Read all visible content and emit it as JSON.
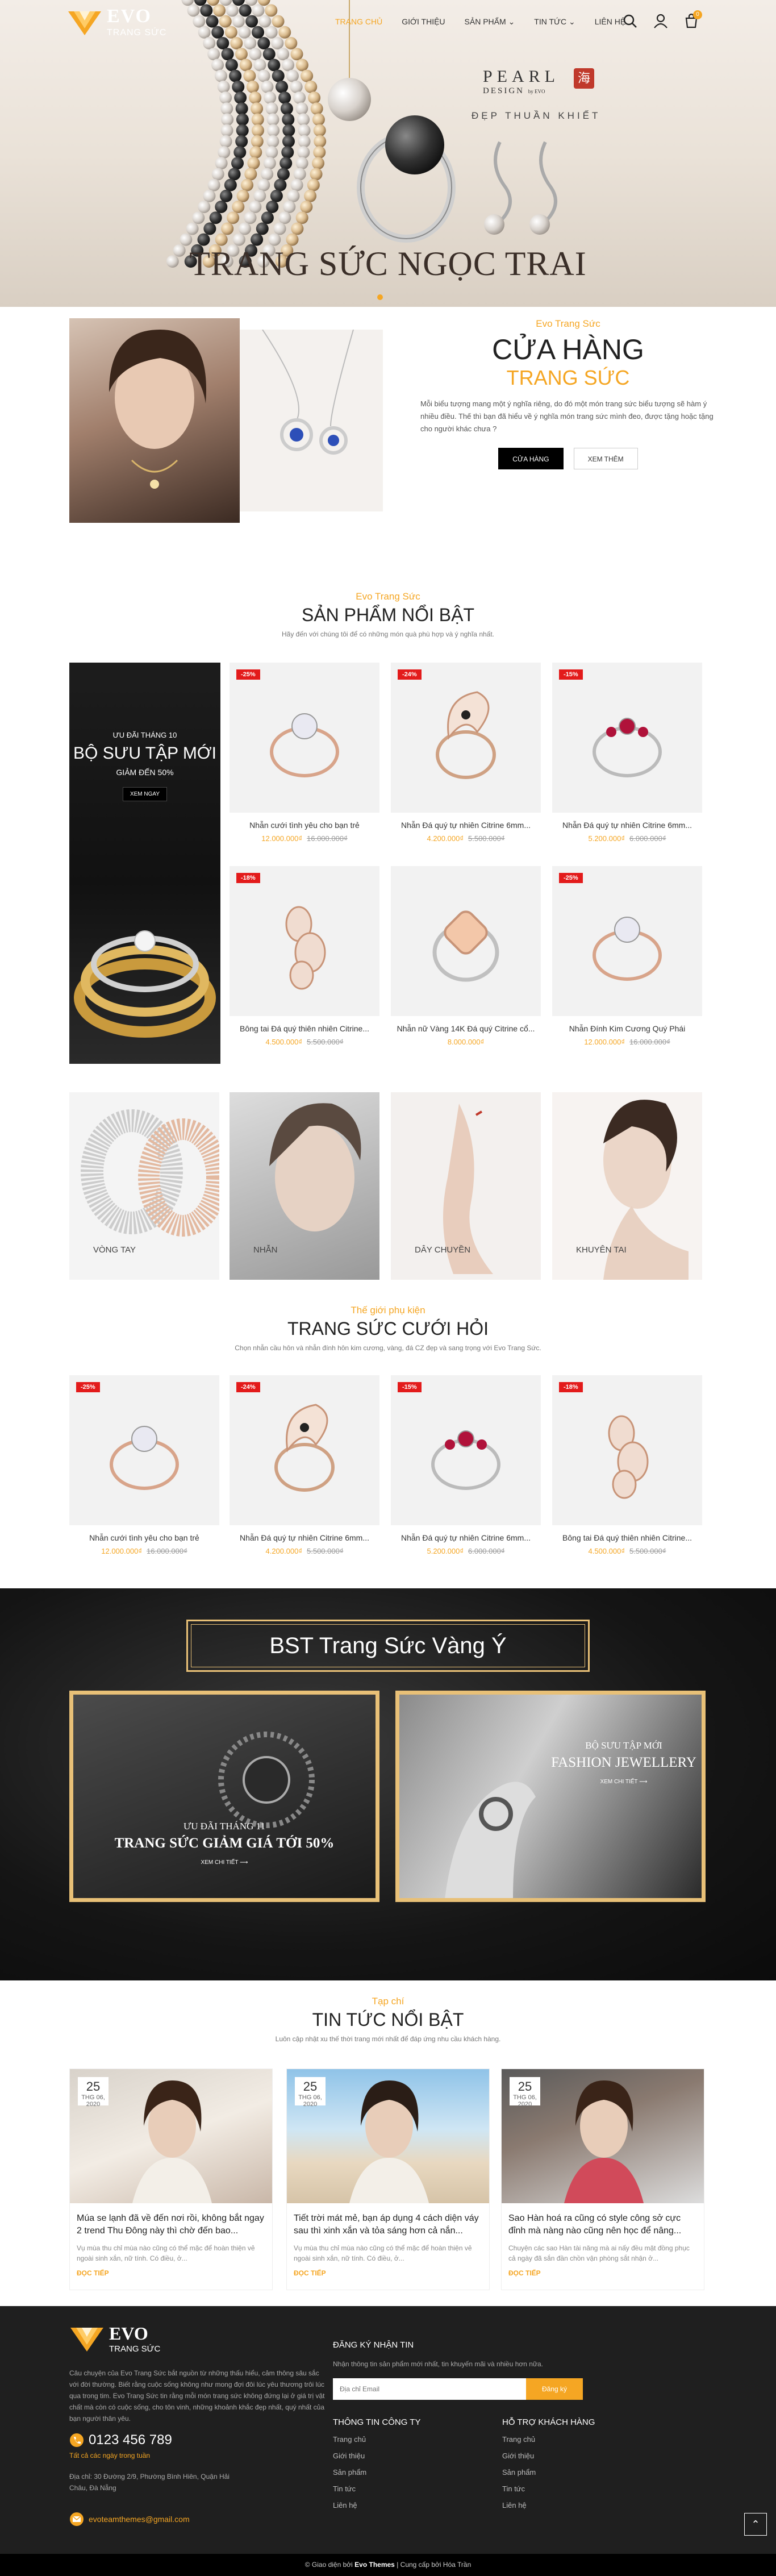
{
  "colors": {
    "accent": "#f5a623",
    "sale": "#e31b1b",
    "dark": "#1f1f1f",
    "gold_frame": "#e8c077"
  },
  "header": {
    "logo": {
      "name": "EVO",
      "sub": "TRANG SỨC"
    },
    "nav": [
      "TRANG CHỦ",
      "GIỚI THIỆU",
      "SẢN PHẨM",
      "TIN TỨC",
      "LIÊN HỆ"
    ],
    "cart_count": "0",
    "icons": [
      "search-icon",
      "user-icon",
      "cart-icon"
    ]
  },
  "hero": {
    "brand": "PEARL",
    "design": "DESIGN",
    "by": "by EVO",
    "seal": "海",
    "tagline": "ĐẸP THUẦN KHIẾT",
    "title": "TRANG SỨC NGỌC TRAI"
  },
  "about": {
    "kicker": "Evo Trang Sức",
    "title_1": "CỬA HÀNG",
    "title_2": "TRANG SỨC",
    "text": "Mỗi biểu tượng mang một ý nghĩa riêng, do đó một món trang sức biểu tượng sẽ hàm ý nhiều điều. Thế thì bạn đã hiểu về ý nghĩa món trang sức mình đeo, được tặng hoặc tặng cho người khác chưa ?",
    "btn_shop": "CỬA HÀNG",
    "btn_more": "XEM THÊM"
  },
  "featured": {
    "kicker": "Evo Trang Sức",
    "title": "SẢN PHẨM NỔI BẬT",
    "desc": "Hãy đến với chúng tôi để có những món quà phù hợp và ý nghĩa nhất.",
    "promo": {
      "line1": "ƯU ĐÃI THÁNG 10",
      "line2": "BỘ SƯU TẬP MỚI",
      "line3": "GIẢM ĐẾN 50%",
      "btn": "XEM NGAY"
    },
    "products": [
      {
        "sale": "-25%",
        "name": "Nhẫn cưới tình yêu cho bạn trẻ",
        "price": "12.000.000₫",
        "old": "16.000.000₫"
      },
      {
        "sale": "-24%",
        "name": "Nhẫn Đá quý tự nhiên Citrine 6mm...",
        "price": "4.200.000₫",
        "old": "5.500.000₫"
      },
      {
        "sale": "-15%",
        "name": "Nhẫn Đá quý tự nhiên Citrine 6mm...",
        "price": "5.200.000₫",
        "old": "6.000.000₫"
      },
      {
        "sale": "-18%",
        "name": "Bông tai Đá quý thiên nhiên Citrine...",
        "price": "4.500.000₫",
        "old": "5.500.000₫"
      },
      {
        "sale": "",
        "name": "Nhẫn nữ Vàng 14K Đá quý Citrine cổ...",
        "price": "8.000.000₫",
        "old": ""
      },
      {
        "sale": "-25%",
        "name": "Nhẫn Đính Kim Cương Quý Phái",
        "price": "12.000.000₫",
        "old": "16.000.000₫"
      }
    ]
  },
  "categories": [
    "VÒNG TAY",
    "NHẪN",
    "DÂY CHUYỀN",
    "KHUYÊN TAI"
  ],
  "wedding": {
    "kicker": "Thế giới phụ kiện",
    "title": "TRANG SỨC CƯỚI HỎI",
    "desc": "Chọn nhẫn cầu hôn và nhẫn đính hôn kim cương, vàng, đá CZ đẹp và sang trọng với Evo Trang Sức.",
    "products": [
      {
        "sale": "-25%",
        "name": "Nhẫn cưới tình yêu cho bạn trẻ",
        "price": "12.000.000₫",
        "old": "16.000.000₫"
      },
      {
        "sale": "-24%",
        "name": "Nhẫn Đá quý tự nhiên Citrine 6mm...",
        "price": "4.200.000₫",
        "old": "5.500.000₫"
      },
      {
        "sale": "-15%",
        "name": "Nhẫn Đá quý tự nhiên Citrine 6mm...",
        "price": "5.200.000₫",
        "old": "6.000.000₫"
      },
      {
        "sale": "-18%",
        "name": "Bông tai Đá quý thiên nhiên Citrine...",
        "price": "4.500.000₫",
        "old": "5.500.000₫"
      }
    ]
  },
  "bst": {
    "title": "BST Trang Sức Vàng Ý",
    "left": {
      "line1": "ƯU ĐÃI THÁNG 11",
      "line2": "TRANG SỨC GIẢM GIÁ TỚI 50%",
      "btn": "XEM CHI TIẾT"
    },
    "right": {
      "line1": "BỘ SƯU TẬP MỚI",
      "line2": "FASHION JEWELLERY",
      "btn": "XEM CHI TIẾT"
    }
  },
  "news": {
    "kicker": "Tạp chí",
    "title": "TIN TỨC NỔI BẬT",
    "desc": "Luôn cập nhật xu thế thời trang mới nhất để đáp ứng nhu cầu khách hàng.",
    "items": [
      {
        "day": "25",
        "month": "THG 06, 2020",
        "title": "Múa se lạnh đã về đến nơi rồi, không bắt ngay 2 trend Thu Đông này thì chờ đến bao...",
        "excerpt": "Vụ mùa thu chỉ mùa nào cũng có thể mặc để hoàn thiện vẻ ngoài sinh xắn, nữ tính. Có điều, ở...",
        "more": "ĐỌC TIẾP"
      },
      {
        "day": "25",
        "month": "THG 06, 2020",
        "title": "Tiết trời mát mẻ, bạn áp dụng 4 cách diện váy sau thì xinh xắn và tỏa sáng hơn cả nắn...",
        "excerpt": "Vụ mùa thu chỉ mùa nào cũng có thể mặc để hoàn thiện vẻ ngoài sinh xắn, nữ tính. Có điều, ở...",
        "more": "ĐỌC TIẾP"
      },
      {
        "day": "25",
        "month": "THG 06, 2020",
        "title": "Sao Hàn hoá ra cũng có style công sở cực đỉnh mà nàng nào cũng nên học để nâng...",
        "excerpt": "Chuyện các sao Hàn tài năng mà ai nấy đều mặt đồng phục cả ngày đã sắn đần chồn vận phòng sắt nhận ở...",
        "more": "ĐỌC TIẾP"
      }
    ]
  },
  "footer": {
    "logo": {
      "name": "EVO",
      "sub": "TRANG SỨC"
    },
    "about": "Câu chuyện của Evo Trang Sức bắt nguồn từ những thấu hiểu, cảm thông sâu sắc với đời thường. Biết rằng cuộc sống không như mong đợi đôi lúc yêu thương trôi lúc qua trong tim. Evo Trang Sức tin rằng mỗi món trang sức không đứng lại ở giá trị vật chất mà còn có cuộc sống, cho tôn vinh, những khoảnh khắc đẹp nhất, quý nhất của bạn người thân yêu.",
    "phone": "0123 456 789",
    "stores": "Tất cả các ngày trong tuần",
    "address": "Địa chỉ: 30 Đường 2/9, Phường Bình Hiên, Quận Hải Châu, Đà Nẵng",
    "email": "evoteamthemes@gmail.com",
    "newsletter": {
      "title": "ĐĂNG KÝ NHẬN TIN",
      "desc": "Nhận thông tin sản phẩm mới nhất, tin khuyến mãi và nhiều hơn nữa.",
      "placeholder": "Địa chỉ Email",
      "btn": "Đăng ký"
    },
    "col1": {
      "title": "THÔNG TIN CÔNG TY",
      "links": [
        "Trang chủ",
        "Giới thiệu",
        "Sản phẩm",
        "Tin tức",
        "Liên hệ"
      ]
    },
    "col2": {
      "title": "HỖ TRỢ KHÁCH HÀNG",
      "links": [
        "Trang chủ",
        "Giới thiệu",
        "Sản phẩm",
        "Tin tức",
        "Liên hệ"
      ]
    },
    "copy_1": "© Giao diện bởi",
    "copy_brand": "Evo Themes",
    "copy_2": "| Cung cấp bởi Hóa Trần"
  }
}
